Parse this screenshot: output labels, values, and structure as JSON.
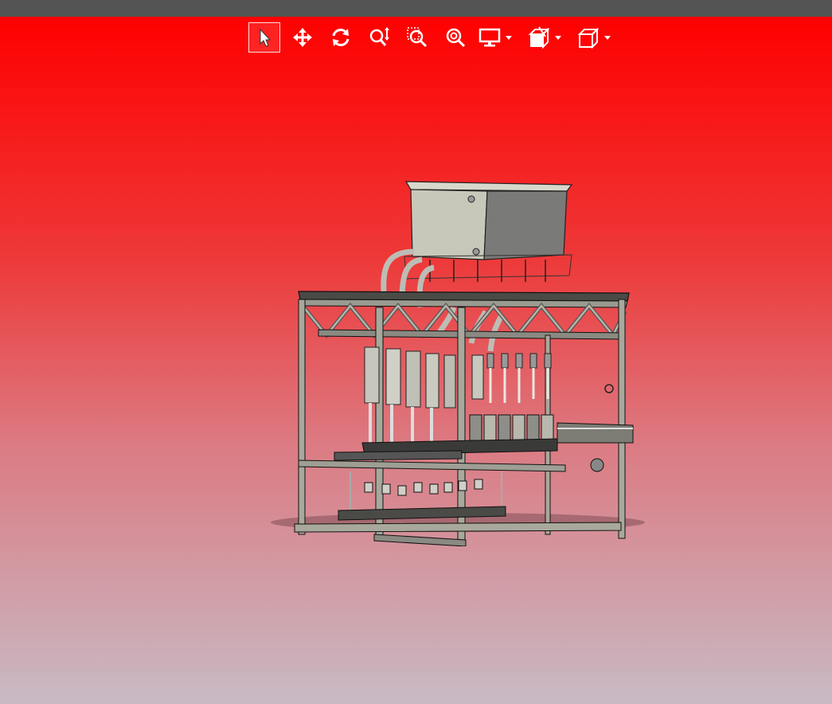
{
  "window": {
    "titlebar_color": "#545454"
  },
  "viewport": {
    "background_top": "#ff0000",
    "background_bottom": "#c8bac4"
  },
  "toolbar": {
    "tools": [
      {
        "name": "select",
        "icon": "arrow-cursor-icon",
        "active": true
      },
      {
        "name": "pan",
        "icon": "move-arrows-icon",
        "active": false
      },
      {
        "name": "rotate",
        "icon": "rotate-icon",
        "active": false
      },
      {
        "name": "zoom",
        "icon": "zoom-updown-icon",
        "active": false
      },
      {
        "name": "zoom-window",
        "icon": "zoom-window-icon",
        "active": false
      },
      {
        "name": "zoom-fit",
        "icon": "zoom-fit-icon",
        "active": false
      },
      {
        "name": "display-mode",
        "icon": "monitor-icon",
        "has_menu": true
      },
      {
        "name": "section-view",
        "icon": "section-cube-icon",
        "has_menu": true
      },
      {
        "name": "view-orientation",
        "icon": "cube-icon",
        "has_menu": true
      }
    ]
  },
  "model": {
    "description_icon": "filling-machine-3d-model",
    "frame_color": "#9a9a90",
    "tank_color": "#c8c8bc"
  }
}
